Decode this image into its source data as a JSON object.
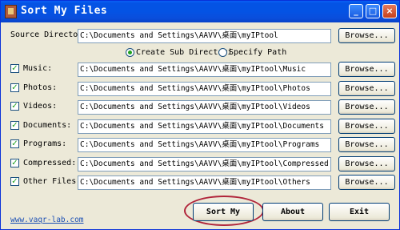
{
  "window": {
    "title": "Sort My Files",
    "controls": {
      "minimize": "_",
      "maximize": "□",
      "close": "×"
    }
  },
  "source": {
    "label": "Source Directory",
    "path": "C:\\Documents and Settings\\AAVV\\桌面\\myIPtool",
    "browse": "Browse..."
  },
  "options": {
    "create_sub": "Create Sub Directori",
    "specify_path": "Specify Path",
    "selected": "create_sub"
  },
  "categories": [
    {
      "label": "Music:",
      "path": "C:\\Documents and Settings\\AAVV\\桌面\\myIPtool\\Music",
      "checked": true,
      "browse": "Browse..."
    },
    {
      "label": "Photos:",
      "path": "C:\\Documents and Settings\\AAVV\\桌面\\myIPtool\\Photos",
      "checked": true,
      "browse": "Browse..."
    },
    {
      "label": "Videos:",
      "path": "C:\\Documents and Settings\\AAVV\\桌面\\myIPtool\\Videos",
      "checked": true,
      "browse": "Browse..."
    },
    {
      "label": "Documents:",
      "path": "C:\\Documents and Settings\\AAVV\\桌面\\myIPtool\\Documents",
      "checked": true,
      "browse": "Browse..."
    },
    {
      "label": "Programs:",
      "path": "C:\\Documents and Settings\\AAVV\\桌面\\myIPtool\\Programs",
      "checked": true,
      "browse": "Browse..."
    },
    {
      "label": "Compressed:",
      "path": "C:\\Documents and Settings\\AAVV\\桌面\\myIPtool\\Compressed",
      "checked": true,
      "browse": "Browse..."
    },
    {
      "label": "Other Files:",
      "path": "C:\\Documents and Settings\\AAVV\\桌面\\myIPtool\\Others",
      "checked": true,
      "browse": "Browse..."
    }
  ],
  "buttons": {
    "sort": "Sort My",
    "about": "About",
    "exit": "Exit"
  },
  "footer": {
    "link": "www.vaqr-lab.com"
  },
  "colors": {
    "titlebar": "#0453e4",
    "face": "#ece9d8",
    "check": "#21a121",
    "highlight": "#b0243a",
    "link": "#1b4fb4"
  }
}
